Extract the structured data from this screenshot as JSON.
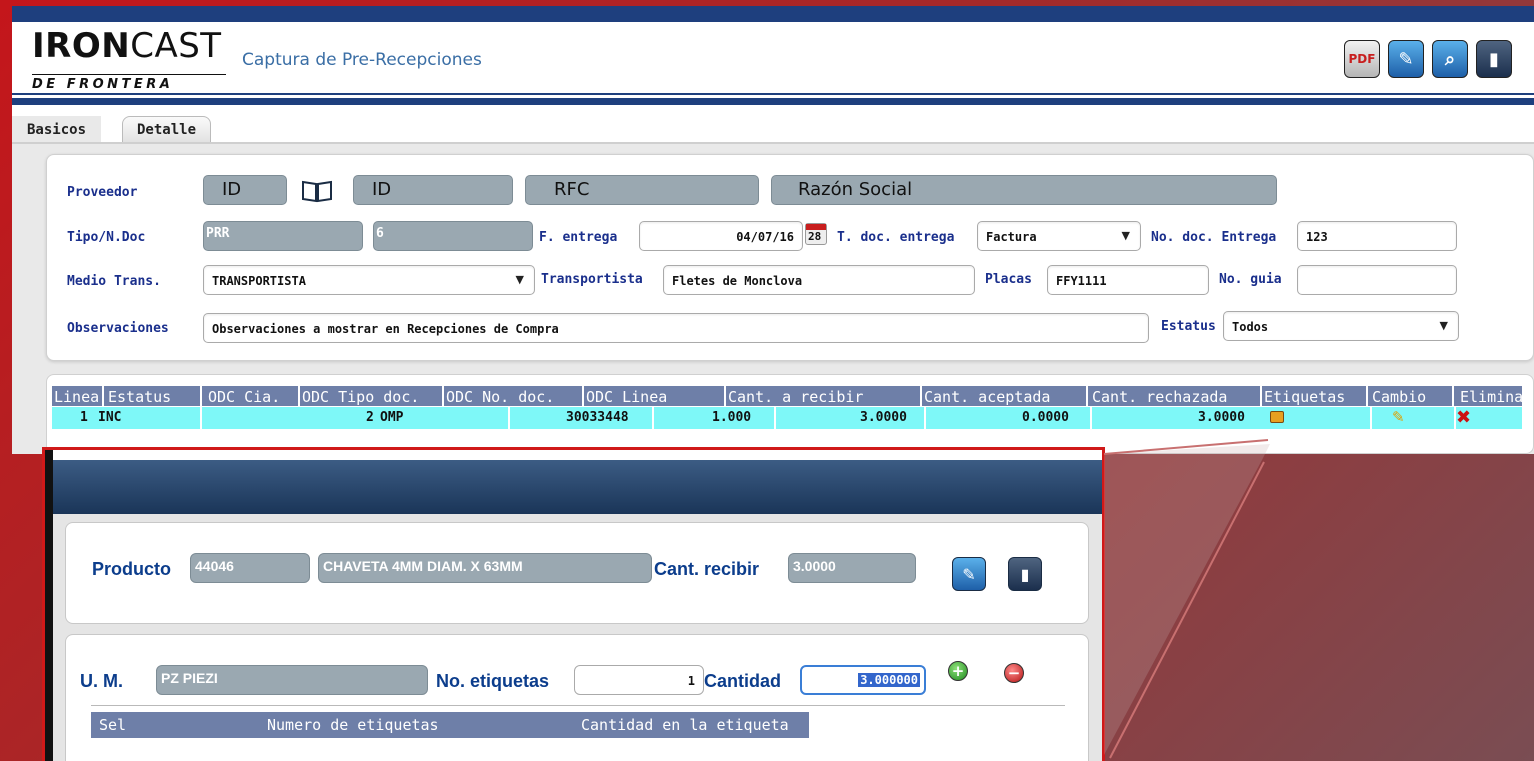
{
  "brand": {
    "logo_main_bold": "IRON",
    "logo_main_light": "CAST",
    "logo_sub": "DE FRONTERA",
    "app_title": "Captura de Pre-Recepciones"
  },
  "toolbar": {
    "pdf_label": "PDF",
    "icons": [
      "pdf-icon",
      "save-icon",
      "search-icon",
      "exit-icon"
    ]
  },
  "tabs": [
    {
      "label": "Basicos",
      "active": true
    },
    {
      "label": "Detalle",
      "active": false
    }
  ],
  "form": {
    "proveedor": {
      "label": "Proveedor",
      "id1": "ID",
      "id2": "ID",
      "rfc": "RFC",
      "razon_social": "Razón Social"
    },
    "tipo_doc": {
      "label": "Tipo/N.Doc",
      "tipo": "PRR",
      "numero": "6"
    },
    "f_entrega": {
      "label": "F. entrega",
      "value": "04/07/16",
      "calendar_day": "28"
    },
    "t_doc_entrega": {
      "label": "T. doc. entrega",
      "value": "Factura"
    },
    "no_doc_entrega": {
      "label": "No. doc. Entrega",
      "value": "123"
    },
    "medio_trans": {
      "label": "Medio Trans.",
      "value": "TRANSPORTISTA"
    },
    "transportista": {
      "label": "Transportista",
      "value": "Fletes de Monclova"
    },
    "placas": {
      "label": "Placas",
      "value": "FFY1111"
    },
    "no_guia": {
      "label": "No. guia",
      "value": ""
    },
    "observaciones": {
      "label": "Observaciones",
      "value": "Observaciones a mostrar en Recepciones de Compra"
    },
    "estatus": {
      "label": "Estatus",
      "value": "Todos"
    }
  },
  "grid": {
    "columns": [
      "Linea",
      "Estatus",
      "ODC Cia.",
      "ODC Tipo doc.",
      "ODC No. doc.",
      "ODC Linea",
      "Cant. a recibir",
      "Cant. aceptada",
      "Cant. rechazada",
      "Etiquetas",
      "Cambio",
      "Elimina"
    ],
    "rows": [
      {
        "linea": "1",
        "estatus": "INC",
        "odc_cia": "2",
        "odc_tipo": "OMP",
        "odc_no": "30033448",
        "odc_linea": "1.000",
        "cant_recibir": "3.0000",
        "cant_aceptada": "0.0000",
        "cant_rechazada": "3.0000"
      }
    ]
  },
  "popup": {
    "producto_label": "Producto",
    "producto_code": "44046",
    "producto_desc": "CHAVETA 4MM DIAM. X 63MM",
    "cant_recibir_label": "Cant. recibir",
    "cant_recibir": "3.0000",
    "um_label": "U. M.",
    "um_value": "PZ PIEZI",
    "no_etiquetas_label": "No. etiquetas",
    "no_etiquetas": "1",
    "cantidad_label": "Cantidad",
    "cantidad": "3.000000",
    "table_columns": [
      "Sel",
      "Numero de etiquetas",
      "Cantidad en la etiqueta"
    ]
  },
  "colors": {
    "brand_blue": "#1e3f7e",
    "label_blue": "#1a2f8c",
    "grid_header": "#6e7fa8",
    "grid_row": "#7ef8f8",
    "callout_red": "#d01919",
    "delete_red": "#cc1111"
  }
}
